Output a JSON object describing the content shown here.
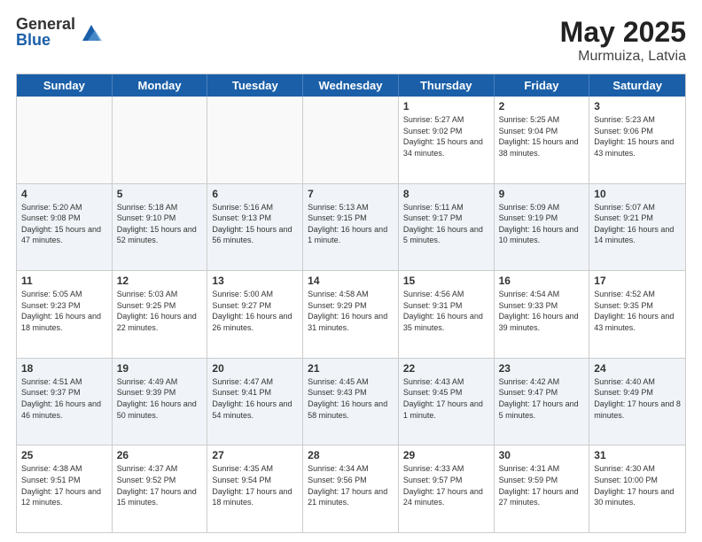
{
  "header": {
    "logo_general": "General",
    "logo_blue": "Blue",
    "title": "May 2025",
    "location": "Murmuiza, Latvia"
  },
  "days_of_week": [
    "Sunday",
    "Monday",
    "Tuesday",
    "Wednesday",
    "Thursday",
    "Friday",
    "Saturday"
  ],
  "rows": [
    [
      {
        "day": "",
        "info": "",
        "empty": true
      },
      {
        "day": "",
        "info": "",
        "empty": true
      },
      {
        "day": "",
        "info": "",
        "empty": true
      },
      {
        "day": "",
        "info": "",
        "empty": true
      },
      {
        "day": "1",
        "info": "Sunrise: 5:27 AM\nSunset: 9:02 PM\nDaylight: 15 hours\nand 34 minutes."
      },
      {
        "day": "2",
        "info": "Sunrise: 5:25 AM\nSunset: 9:04 PM\nDaylight: 15 hours\nand 38 minutes."
      },
      {
        "day": "3",
        "info": "Sunrise: 5:23 AM\nSunset: 9:06 PM\nDaylight: 15 hours\nand 43 minutes."
      }
    ],
    [
      {
        "day": "4",
        "info": "Sunrise: 5:20 AM\nSunset: 9:08 PM\nDaylight: 15 hours\nand 47 minutes."
      },
      {
        "day": "5",
        "info": "Sunrise: 5:18 AM\nSunset: 9:10 PM\nDaylight: 15 hours\nand 52 minutes."
      },
      {
        "day": "6",
        "info": "Sunrise: 5:16 AM\nSunset: 9:13 PM\nDaylight: 15 hours\nand 56 minutes."
      },
      {
        "day": "7",
        "info": "Sunrise: 5:13 AM\nSunset: 9:15 PM\nDaylight: 16 hours\nand 1 minute."
      },
      {
        "day": "8",
        "info": "Sunrise: 5:11 AM\nSunset: 9:17 PM\nDaylight: 16 hours\nand 5 minutes."
      },
      {
        "day": "9",
        "info": "Sunrise: 5:09 AM\nSunset: 9:19 PM\nDaylight: 16 hours\nand 10 minutes."
      },
      {
        "day": "10",
        "info": "Sunrise: 5:07 AM\nSunset: 9:21 PM\nDaylight: 16 hours\nand 14 minutes."
      }
    ],
    [
      {
        "day": "11",
        "info": "Sunrise: 5:05 AM\nSunset: 9:23 PM\nDaylight: 16 hours\nand 18 minutes."
      },
      {
        "day": "12",
        "info": "Sunrise: 5:03 AM\nSunset: 9:25 PM\nDaylight: 16 hours\nand 22 minutes."
      },
      {
        "day": "13",
        "info": "Sunrise: 5:00 AM\nSunset: 9:27 PM\nDaylight: 16 hours\nand 26 minutes."
      },
      {
        "day": "14",
        "info": "Sunrise: 4:58 AM\nSunset: 9:29 PM\nDaylight: 16 hours\nand 31 minutes."
      },
      {
        "day": "15",
        "info": "Sunrise: 4:56 AM\nSunset: 9:31 PM\nDaylight: 16 hours\nand 35 minutes."
      },
      {
        "day": "16",
        "info": "Sunrise: 4:54 AM\nSunset: 9:33 PM\nDaylight: 16 hours\nand 39 minutes."
      },
      {
        "day": "17",
        "info": "Sunrise: 4:52 AM\nSunset: 9:35 PM\nDaylight: 16 hours\nand 43 minutes."
      }
    ],
    [
      {
        "day": "18",
        "info": "Sunrise: 4:51 AM\nSunset: 9:37 PM\nDaylight: 16 hours\nand 46 minutes."
      },
      {
        "day": "19",
        "info": "Sunrise: 4:49 AM\nSunset: 9:39 PM\nDaylight: 16 hours\nand 50 minutes."
      },
      {
        "day": "20",
        "info": "Sunrise: 4:47 AM\nSunset: 9:41 PM\nDaylight: 16 hours\nand 54 minutes."
      },
      {
        "day": "21",
        "info": "Sunrise: 4:45 AM\nSunset: 9:43 PM\nDaylight: 16 hours\nand 58 minutes."
      },
      {
        "day": "22",
        "info": "Sunrise: 4:43 AM\nSunset: 9:45 PM\nDaylight: 17 hours\nand 1 minute."
      },
      {
        "day": "23",
        "info": "Sunrise: 4:42 AM\nSunset: 9:47 PM\nDaylight: 17 hours\nand 5 minutes."
      },
      {
        "day": "24",
        "info": "Sunrise: 4:40 AM\nSunset: 9:49 PM\nDaylight: 17 hours\nand 8 minutes."
      }
    ],
    [
      {
        "day": "25",
        "info": "Sunrise: 4:38 AM\nSunset: 9:51 PM\nDaylight: 17 hours\nand 12 minutes."
      },
      {
        "day": "26",
        "info": "Sunrise: 4:37 AM\nSunset: 9:52 PM\nDaylight: 17 hours\nand 15 minutes."
      },
      {
        "day": "27",
        "info": "Sunrise: 4:35 AM\nSunset: 9:54 PM\nDaylight: 17 hours\nand 18 minutes."
      },
      {
        "day": "28",
        "info": "Sunrise: 4:34 AM\nSunset: 9:56 PM\nDaylight: 17 hours\nand 21 minutes."
      },
      {
        "day": "29",
        "info": "Sunrise: 4:33 AM\nSunset: 9:57 PM\nDaylight: 17 hours\nand 24 minutes."
      },
      {
        "day": "30",
        "info": "Sunrise: 4:31 AM\nSunset: 9:59 PM\nDaylight: 17 hours\nand 27 minutes."
      },
      {
        "day": "31",
        "info": "Sunrise: 4:30 AM\nSunset: 10:00 PM\nDaylight: 17 hours\nand 30 minutes."
      }
    ]
  ]
}
